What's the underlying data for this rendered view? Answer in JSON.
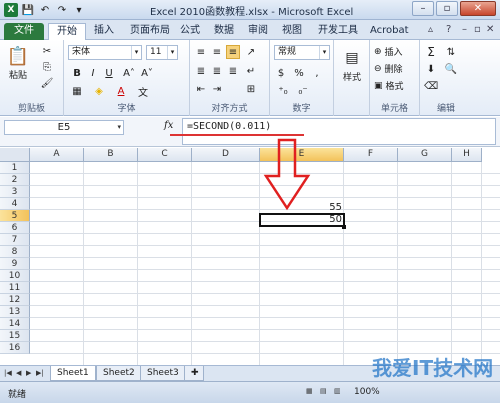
{
  "window": {
    "title": "Excel 2010函数教程.xlsx - Microsoft Excel",
    "app_icon": "X"
  },
  "tabs": [
    "文件",
    "开始",
    "插入",
    "页面布局",
    "公式",
    "数据",
    "审阅",
    "视图",
    "开发工具",
    "Acrobat"
  ],
  "ribbon": {
    "paste_label": "粘贴",
    "clipboard_label": "剪贴板",
    "font_name": "宋体",
    "font_size": "11",
    "font_label": "字体",
    "align_label": "对齐方式",
    "number_format": "常规",
    "number_label": "数字",
    "style_label": "样式",
    "cells_label": "单元格",
    "insert_label": "插入",
    "delete_label": "删除",
    "format_label": "格式",
    "editing_label": "编辑",
    "bold": "B",
    "italic": "I",
    "underline": "U",
    "font_color_icon": "A",
    "wen": "文",
    "percent": "%",
    "comma": ",",
    "currency": "$"
  },
  "formula_bar": {
    "name_box": "E5",
    "fx": "fx",
    "formula": "=SECOND(0.011)"
  },
  "columns": [
    "A",
    "B",
    "C",
    "D",
    "E",
    "F",
    "G",
    "H"
  ],
  "rows": [
    "1",
    "2",
    "3",
    "4",
    "5",
    "6",
    "7",
    "8",
    "9",
    "10",
    "11",
    "12",
    "13",
    "14",
    "15",
    "16"
  ],
  "cells": {
    "E4": "55",
    "E5": "50"
  },
  "sheets": [
    "Sheet1",
    "Sheet2",
    "Sheet3"
  ],
  "status": {
    "ready": "就绪",
    "zoom": "100%"
  },
  "watermark": "我爱IT技术网",
  "colors": {
    "file_tab": "#2c7a3e",
    "arrow": "#e02020",
    "selected_header": "#f3c25b"
  }
}
